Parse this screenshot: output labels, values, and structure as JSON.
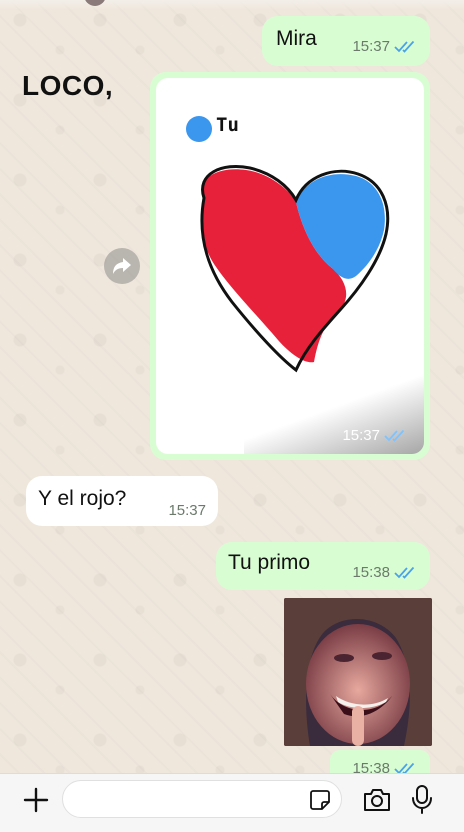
{
  "chat": {
    "messages": [
      {
        "text": "Mira",
        "time": "15:37"
      },
      {
        "caption_left": "LOCO,",
        "legend_label": "Tu",
        "time": "15:37"
      },
      {
        "text": "Y el rojo?",
        "time": "15:37"
      },
      {
        "text": "Tu primo",
        "time": "15:38"
      },
      {
        "time": "15:38"
      }
    ]
  },
  "composer": {
    "placeholder": ""
  },
  "colors": {
    "outgoing_bubble": "#d9fdd3",
    "incoming_bubble": "#ffffff",
    "read_ticks": "#4aa3e8",
    "heart_red": "#e8213a",
    "heart_blue": "#3b96ee"
  },
  "icons": [
    "double-check-icon",
    "forward-icon",
    "plus-icon",
    "sticker-icon",
    "camera-icon",
    "microphone-icon"
  ]
}
